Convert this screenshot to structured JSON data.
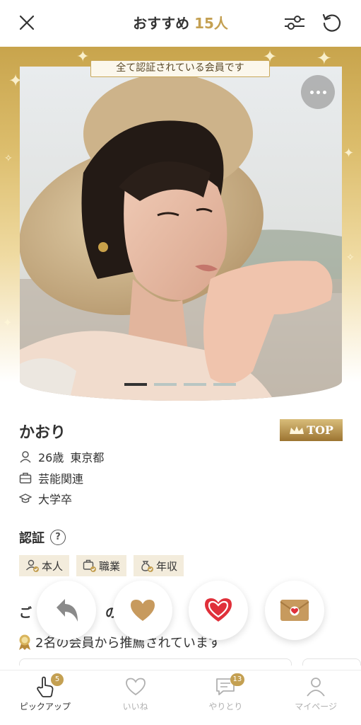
{
  "header": {
    "title": "おすすめ",
    "count": "15人",
    "icons": [
      "close-icon",
      "filter-sliders-icon",
      "refresh-icon"
    ]
  },
  "photo": {
    "verified_label": "全て認証されている会員です",
    "more_icon": "more-horizontal-icon",
    "page_indicator": {
      "total": 4,
      "current": 1
    }
  },
  "profile": {
    "name": "かおり",
    "rank_badge": "TOP",
    "age": "26歳",
    "location": "東京都",
    "occupation": "芸能関連",
    "education": "大学卒"
  },
  "certification": {
    "title": "認証",
    "tags": [
      "本人",
      "職業",
      "年収"
    ]
  },
  "recommend": {
    "title_visible": "ご",
    "title_tail": "の",
    "text": "2名の会員から推薦されています"
  },
  "actions": {
    "icons": [
      "undo-arrow-icon",
      "like-heart-icon",
      "super-like-heart-icon",
      "message-envelope-icon"
    ]
  },
  "nav": {
    "items": [
      {
        "label": "ピックアップ",
        "badge": "5",
        "icon": "pointer-hand-icon"
      },
      {
        "label": "いいね",
        "badge": "",
        "icon": "heart-outline-icon"
      },
      {
        "label": "やりとり",
        "badge": "13",
        "icon": "chat-bubble-icon"
      },
      {
        "label": "マイページ",
        "badge": "",
        "icon": "person-icon"
      }
    ]
  },
  "colors": {
    "gold": "#c4a052",
    "brand_red": "#e0303a",
    "brown_heart": "#c79a5e",
    "text": "#333333"
  }
}
